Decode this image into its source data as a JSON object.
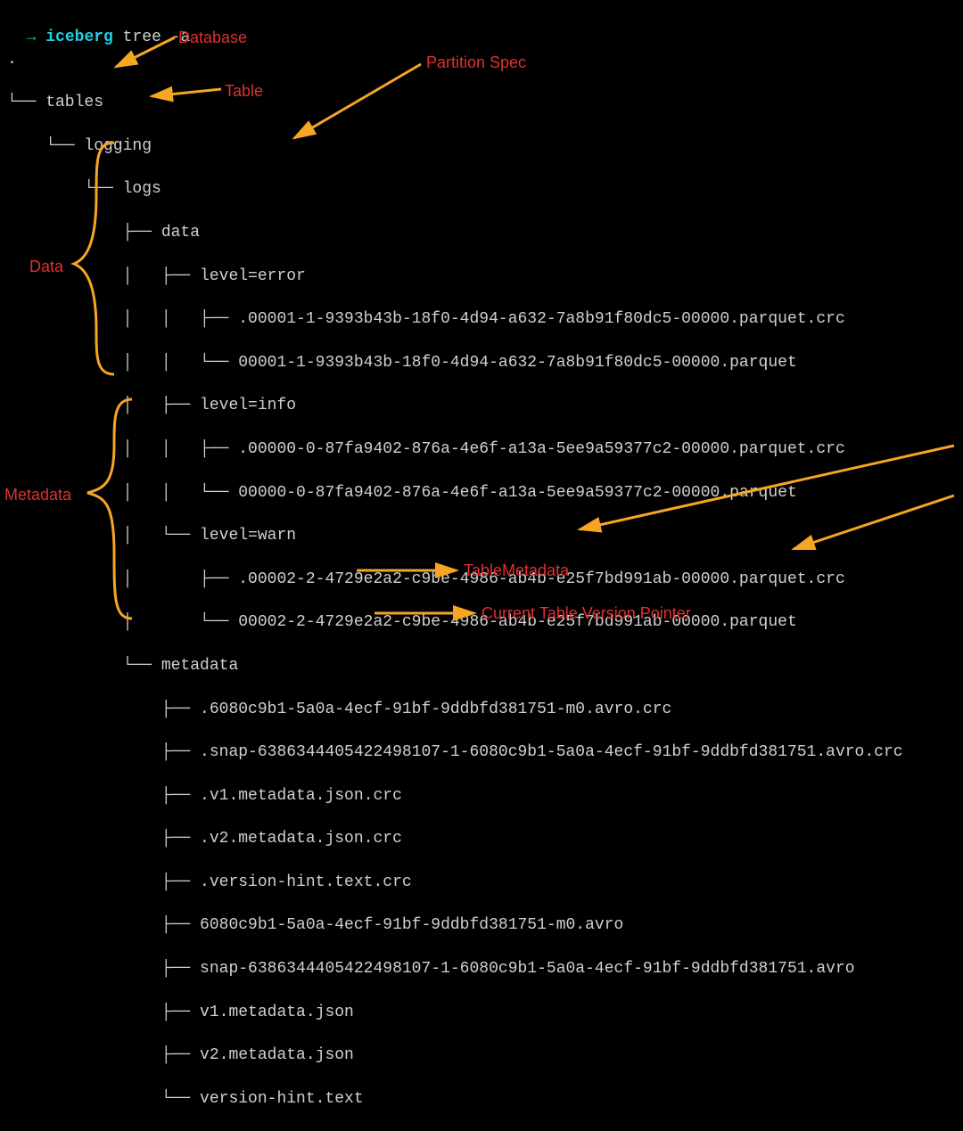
{
  "prompt": {
    "arrow": "→",
    "host": "iceberg",
    "command": "tree -a"
  },
  "dot": ".",
  "lines": {
    "l0": "└── tables",
    "l1": "    └── logging",
    "l2": "        └── logs",
    "l3": "            ├── data",
    "l4": "            │   ├── level=error",
    "l5": "            │   │   ├── .00001-1-9393b43b-18f0-4d94-a632-7a8b91f80dc5-00000.parquet.crc",
    "l6": "            │   │   └── 00001-1-9393b43b-18f0-4d94-a632-7a8b91f80dc5-00000.parquet",
    "l7": "            │   ├── level=info",
    "l8": "            │   │   ├── .00000-0-87fa9402-876a-4e6f-a13a-5ee9a59377c2-00000.parquet.crc",
    "l9": "            │   │   └── 00000-0-87fa9402-876a-4e6f-a13a-5ee9a59377c2-00000.parquet",
    "l10": "            │   └── level=warn",
    "l11": "            │       ├── .00002-2-4729e2a2-c9be-4986-ab4b-e25f7bd991ab-00000.parquet.crc",
    "l12": "            │       └── 00002-2-4729e2a2-c9be-4986-ab4b-e25f7bd991ab-00000.parquet",
    "l13": "            └── metadata",
    "l14": "                ├── .6080c9b1-5a0a-4ecf-91bf-9ddbfd381751-m0.avro.crc",
    "l15": "                ├── .snap-6386344405422498107-1-6080c9b1-5a0a-4ecf-91bf-9ddbfd381751.avro.crc",
    "l16": "                ├── .v1.metadata.json.crc",
    "l17": "                ├── .v2.metadata.json.crc",
    "l18": "                ├── .version-hint.text.crc",
    "l19": "                ├── 6080c9b1-5a0a-4ecf-91bf-9ddbfd381751-m0.avro",
    "l20": "                ├── snap-6386344405422498107-1-6080c9b1-5a0a-4ecf-91bf-9ddbfd381751.avro",
    "l21": "                ├── v1.metadata.json",
    "l22": "                ├── v2.metadata.json",
    "l23": "                └── version-hint.text"
  },
  "annotations": {
    "database": "Database",
    "table": "Table",
    "partition_spec": "Partition Spec",
    "data": "Data",
    "metadata": "Metadata",
    "table_metadata": "TableMetadata",
    "version_pointer": "Current Table Version Pointer"
  }
}
